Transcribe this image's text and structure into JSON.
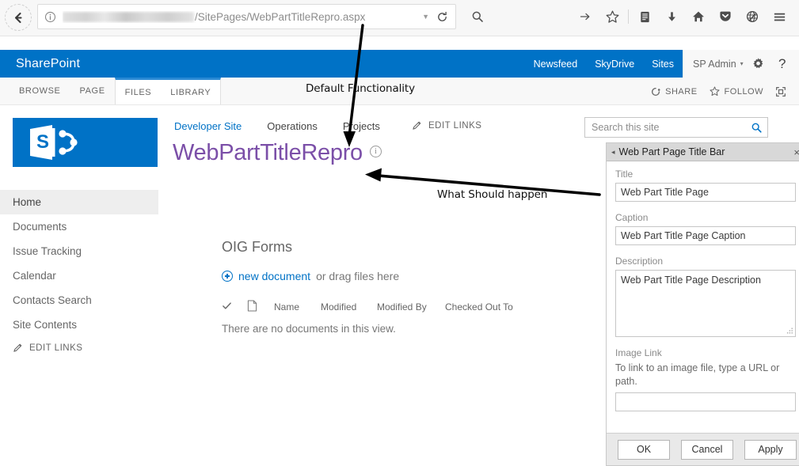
{
  "browser": {
    "back_icon": "back-arrow-icon",
    "identity_icon": "info-identity-icon",
    "url_redacted": "",
    "url_path": "/SitePages/WebPartTitleRepro.aspx",
    "dropdown_icon": "chevron-down-icon",
    "reload_icon": "reload-icon",
    "search_icon": "search-icon",
    "toolbar_icons": [
      {
        "name": "go-arrow-icon"
      },
      {
        "name": "bookmark-star-icon"
      },
      {
        "name": "reading-list-icon"
      },
      {
        "name": "downloads-icon"
      },
      {
        "name": "home-icon"
      },
      {
        "name": "pocket-icon"
      },
      {
        "name": "globe-pen-icon"
      },
      {
        "name": "hamburger-menu-icon"
      }
    ]
  },
  "suitebar": {
    "brand": "SharePoint",
    "links": [
      {
        "label": "Newsfeed",
        "active": false
      },
      {
        "label": "SkyDrive",
        "active": false
      },
      {
        "label": "Sites",
        "active": true
      }
    ],
    "user": "SP Admin",
    "user_caret": "▾",
    "settings_icon": "gear-icon",
    "help_icon": "help-question-icon"
  },
  "ribbon": {
    "tabs": [
      {
        "label": "BROWSE",
        "contextual": false
      },
      {
        "label": "PAGE",
        "contextual": false
      },
      {
        "label": "FILES",
        "contextual": true
      },
      {
        "label": "LIBRARY",
        "contextual": true
      }
    ],
    "share_label": "SHARE",
    "follow_label": "FOLLOW",
    "focus_icon": "focus-on-content-icon",
    "share_icon": "share-icon",
    "follow_icon": "star-icon"
  },
  "left_nav": {
    "logo_name": "sharepoint-logo",
    "items": [
      {
        "label": "Home",
        "selected": true
      },
      {
        "label": "Documents",
        "selected": false
      },
      {
        "label": "Issue Tracking",
        "selected": false
      },
      {
        "label": "Calendar",
        "selected": false
      },
      {
        "label": "Contacts Search",
        "selected": false
      },
      {
        "label": "Site Contents",
        "selected": false
      }
    ],
    "edit_links": "EDIT LINKS"
  },
  "topnav": {
    "items": [
      {
        "label": "Developer Site",
        "current": true
      },
      {
        "label": "Operations",
        "current": false
      },
      {
        "label": "Projects",
        "current": false
      }
    ],
    "edit_links": "EDIT LINKS"
  },
  "page": {
    "title": "WebPartTitleRepro",
    "info_icon": "info-icon"
  },
  "search": {
    "placeholder": "Search this site",
    "icon": "search-icon"
  },
  "library": {
    "title": "OIG Forms",
    "new_document_link": "new document",
    "new_document_rest": "or drag files here",
    "columns": [
      "Name",
      "Modified",
      "Modified By",
      "Checked Out To"
    ],
    "check_icon": "checkmark-icon",
    "doc_icon": "document-icon",
    "empty_message": "There are no documents in this view."
  },
  "webpart_panel": {
    "header": "Web Part Page Title Bar",
    "collapse_icon": "◂",
    "close_icon": "×",
    "title_label": "Title",
    "title_value": "Web Part Title Page",
    "caption_label": "Caption",
    "caption_value": "Web Part Title Page Caption",
    "description_label": "Description",
    "description_value": "Web Part Title Page Description",
    "image_link_label": "Image Link",
    "image_link_help": "To link to an image file, type a URL or path.",
    "image_link_value": "",
    "ok_label": "OK",
    "cancel_label": "Cancel",
    "apply_label": "Apply"
  },
  "annotations": {
    "default_functionality": "Default Functionality",
    "what_should_happen": "What Should happen"
  },
  "colors": {
    "sharepoint_blue": "#0072c6",
    "title_purple": "#7b4fa8",
    "link_blue": "#0072c6",
    "contextual_tab": "#2a8ad4"
  }
}
